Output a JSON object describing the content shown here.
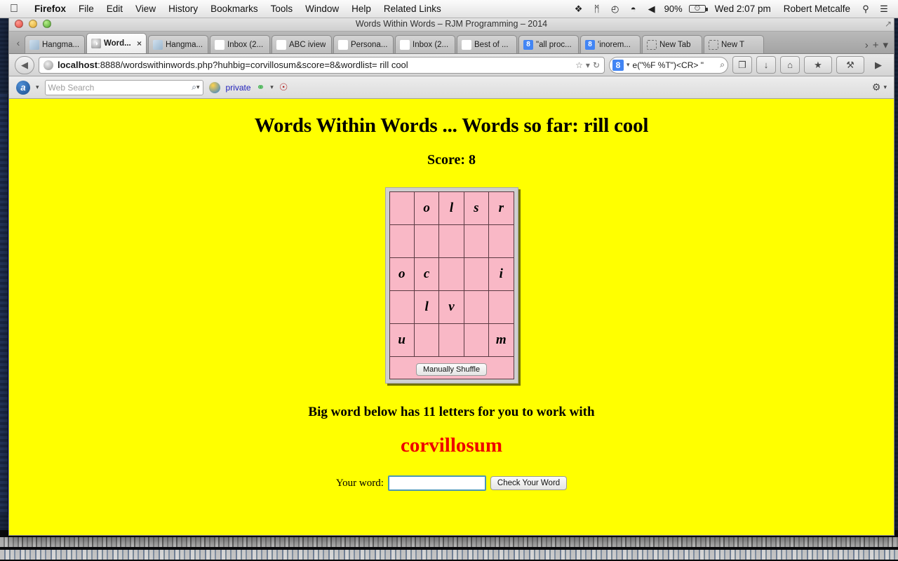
{
  "os_menubar": {
    "apple_icon": "apple-logo-icon",
    "items": [
      {
        "label": "Firefox",
        "bold": true
      },
      {
        "label": "File",
        "bold": false
      },
      {
        "label": "Edit",
        "bold": false
      },
      {
        "label": "View",
        "bold": false
      },
      {
        "label": "History",
        "bold": false
      },
      {
        "label": "Bookmarks",
        "bold": false
      },
      {
        "label": "Tools",
        "bold": false
      },
      {
        "label": "Window",
        "bold": false
      },
      {
        "label": "Help",
        "bold": false
      },
      {
        "label": "Related Links",
        "bold": false
      }
    ],
    "status_icons": [
      {
        "name": "dropbox-icon",
        "glyph": "❖"
      },
      {
        "name": "bluetooth-icon",
        "glyph": "ᛗ"
      },
      {
        "name": "time-machine-icon",
        "glyph": "◴"
      },
      {
        "name": "wifi-icon",
        "glyph": "◓"
      },
      {
        "name": "volume-icon",
        "glyph": "◀"
      }
    ],
    "battery_percent": "90%",
    "battery_bolt": "⚡",
    "clock": "Wed 2:07 pm",
    "user": "Robert Metcalfe",
    "spotlight_icon": "search-icon",
    "notification_icon": "notification-center-icon"
  },
  "window": {
    "title": "Words Within Words – RJM Programming – 2014",
    "traffic_lights": [
      "close",
      "minimize",
      "zoom"
    ]
  },
  "tabbar": {
    "scroll_left_glyph": "‹",
    "overflow_glyph": "›",
    "new_tab_glyph": "+",
    "list_all_glyph": "▾",
    "tabs": [
      {
        "label": "Hangma...",
        "favicon": "page-icon",
        "favicon_class": "fav-page",
        "favicon_text": "",
        "active": false,
        "close": false
      },
      {
        "label": "Word...",
        "favicon": "globe-icon",
        "favicon_class": "fav-globe",
        "favicon_text": "◑",
        "active": true,
        "close": true
      },
      {
        "label": "Hangma...",
        "favicon": "page-icon",
        "favicon_class": "fav-page",
        "favicon_text": "",
        "active": false,
        "close": false
      },
      {
        "label": "Inbox (2...",
        "favicon": "gmail-icon",
        "favicon_class": "fav-gmail",
        "favicon_text": "M",
        "active": false,
        "close": false
      },
      {
        "label": "ABC iview",
        "favicon": "abc-iview-icon",
        "favicon_class": "fav-abc",
        "favicon_text": "▶",
        "active": false,
        "close": false
      },
      {
        "label": "Persona...",
        "favicon": "red-star-icon",
        "favicon_class": "fav-red",
        "favicon_text": "✹",
        "active": false,
        "close": false
      },
      {
        "label": "Inbox (2...",
        "favicon": "gmail-icon",
        "favicon_class": "fav-gmail",
        "favicon_text": "M",
        "active": false,
        "close": false
      },
      {
        "label": "Best of ...",
        "favicon": "dark-page-icon",
        "favicon_class": "fav-dark",
        "favicon_text": "◢",
        "active": false,
        "close": false
      },
      {
        "label": "\"all proc...",
        "favicon": "google-icon",
        "favicon_class": "fav-blue",
        "favicon_text": "8",
        "active": false,
        "close": false
      },
      {
        "label": "'inorem...",
        "favicon": "google-icon",
        "favicon_class": "fav-blue",
        "favicon_text": "8",
        "active": false,
        "close": false
      },
      {
        "label": "New Tab",
        "favicon": "blank-tab-icon",
        "favicon_class": "fav-dash",
        "favicon_text": "",
        "active": false,
        "close": false
      },
      {
        "label": "New T",
        "favicon": "blank-tab-icon",
        "favicon_class": "fav-dash",
        "favicon_text": "",
        "active": false,
        "close": false
      }
    ]
  },
  "navbar": {
    "back_glyph": "◀",
    "url_host": "localhost",
    "url_rest": ":8888/wordswithinwords.php?huhbig=corvillosum&score=8&wordlist= rill cool",
    "bookmark_star_glyph": "☆",
    "star_caret_glyph": "▾",
    "reload_glyph": "↻",
    "search_engine_letter": "8",
    "search_caret_glyph": "▾",
    "search_query": "e(\"%F %T\")<CR> \"",
    "search_go_glyph": "⌕",
    "buttons": [
      {
        "name": "screenshot-button",
        "glyph": "❐"
      },
      {
        "name": "downloads-button",
        "glyph": "↓"
      },
      {
        "name": "home-button",
        "glyph": "⌂"
      },
      {
        "name": "bookmarks-button",
        "glyph": "★"
      },
      {
        "name": "tools-button",
        "glyph": "⚒"
      },
      {
        "name": "play-button",
        "glyph": "▶"
      }
    ]
  },
  "addonbar": {
    "alexa_letter": "a",
    "caret": "▾",
    "websearch_placeholder": "Web Search",
    "websearch_value": "",
    "websearch_icon_glyph": "⌕",
    "private_label": "private",
    "chain_glyph": "⚭",
    "target_glyph": "☉",
    "gear_glyph": "⚙"
  },
  "page": {
    "background_color": "#ffff00",
    "title": "Words Within Words ... Words so far: rill cool",
    "score_line": "Score: 8",
    "grid": {
      "rows": [
        [
          "",
          "o",
          "l",
          "s",
          "r"
        ],
        [
          "",
          "",
          "",
          "",
          ""
        ],
        [
          "o",
          "c",
          "",
          "",
          "i"
        ],
        [
          "",
          "l",
          "v",
          "",
          ""
        ],
        [
          "u",
          "",
          "",
          "",
          "m"
        ]
      ],
      "shuffle_label": "Manually Shuffle",
      "cell_color": "#f9b8c6",
      "frame_color": "#cfcfcf"
    },
    "big_word_note": "Big word below has 11 letters for you to work with",
    "big_word": "corvillosum",
    "big_word_color": "#ee0000",
    "form": {
      "label": "Your word:",
      "input_value": "",
      "input_placeholder": "",
      "submit_label": "Check Your Word"
    }
  }
}
